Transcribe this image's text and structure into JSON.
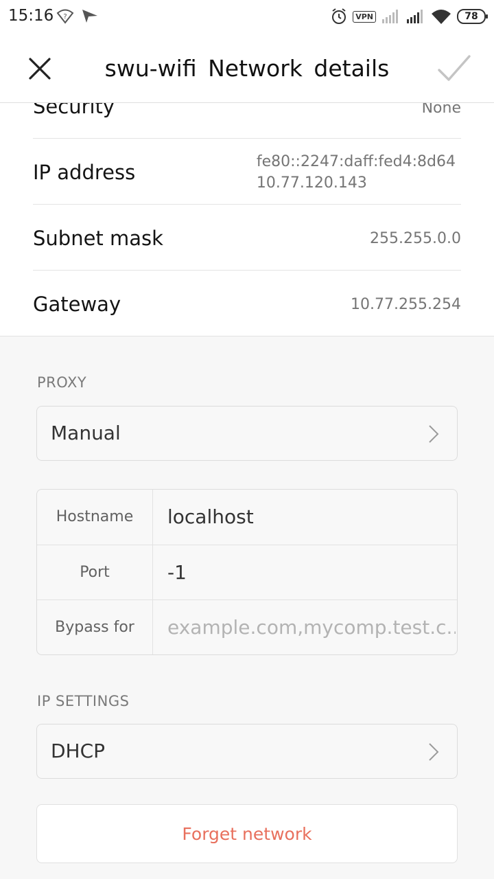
{
  "status_bar": {
    "time": "15:16",
    "vpn_label": "VPN",
    "battery_level": "78",
    "icons": [
      "wifi-question-icon",
      "send-icon",
      "alarm-icon",
      "vpn-icon",
      "signal-icon",
      "signal-icon",
      "wifi-icon",
      "battery-icon"
    ]
  },
  "header": {
    "title": "swu-wifi  Network  details",
    "close_icon": "close-icon",
    "confirm_icon": "checkmark-icon"
  },
  "network_info": [
    {
      "label": "Security",
      "value": "None"
    },
    {
      "label": "IP address",
      "value": "fe80::2247:daff:fed4:8d64\n10.77.120.143",
      "lines": [
        "fe80::2247:daff:fed4:8d64",
        "10.77.120.143"
      ]
    },
    {
      "label": "Subnet mask",
      "value": "255.255.0.0"
    },
    {
      "label": "Gateway",
      "value": "10.77.255.254"
    }
  ],
  "proxy": {
    "section_label": "PROXY",
    "mode": "Manual",
    "fields": [
      {
        "label": "Hostname",
        "value": "localhost",
        "placeholder": ""
      },
      {
        "label": "Port",
        "value": "-1",
        "placeholder": ""
      },
      {
        "label": "Bypass for",
        "value": "",
        "placeholder": "example.com,mycomp.test.c..."
      }
    ]
  },
  "ip_settings": {
    "section_label": "IP SETTINGS",
    "mode": "DHCP"
  },
  "actions": {
    "forget_label": "Forget network"
  },
  "colors": {
    "accent_forget": "#e8705d",
    "background": "#f7f7f7"
  }
}
